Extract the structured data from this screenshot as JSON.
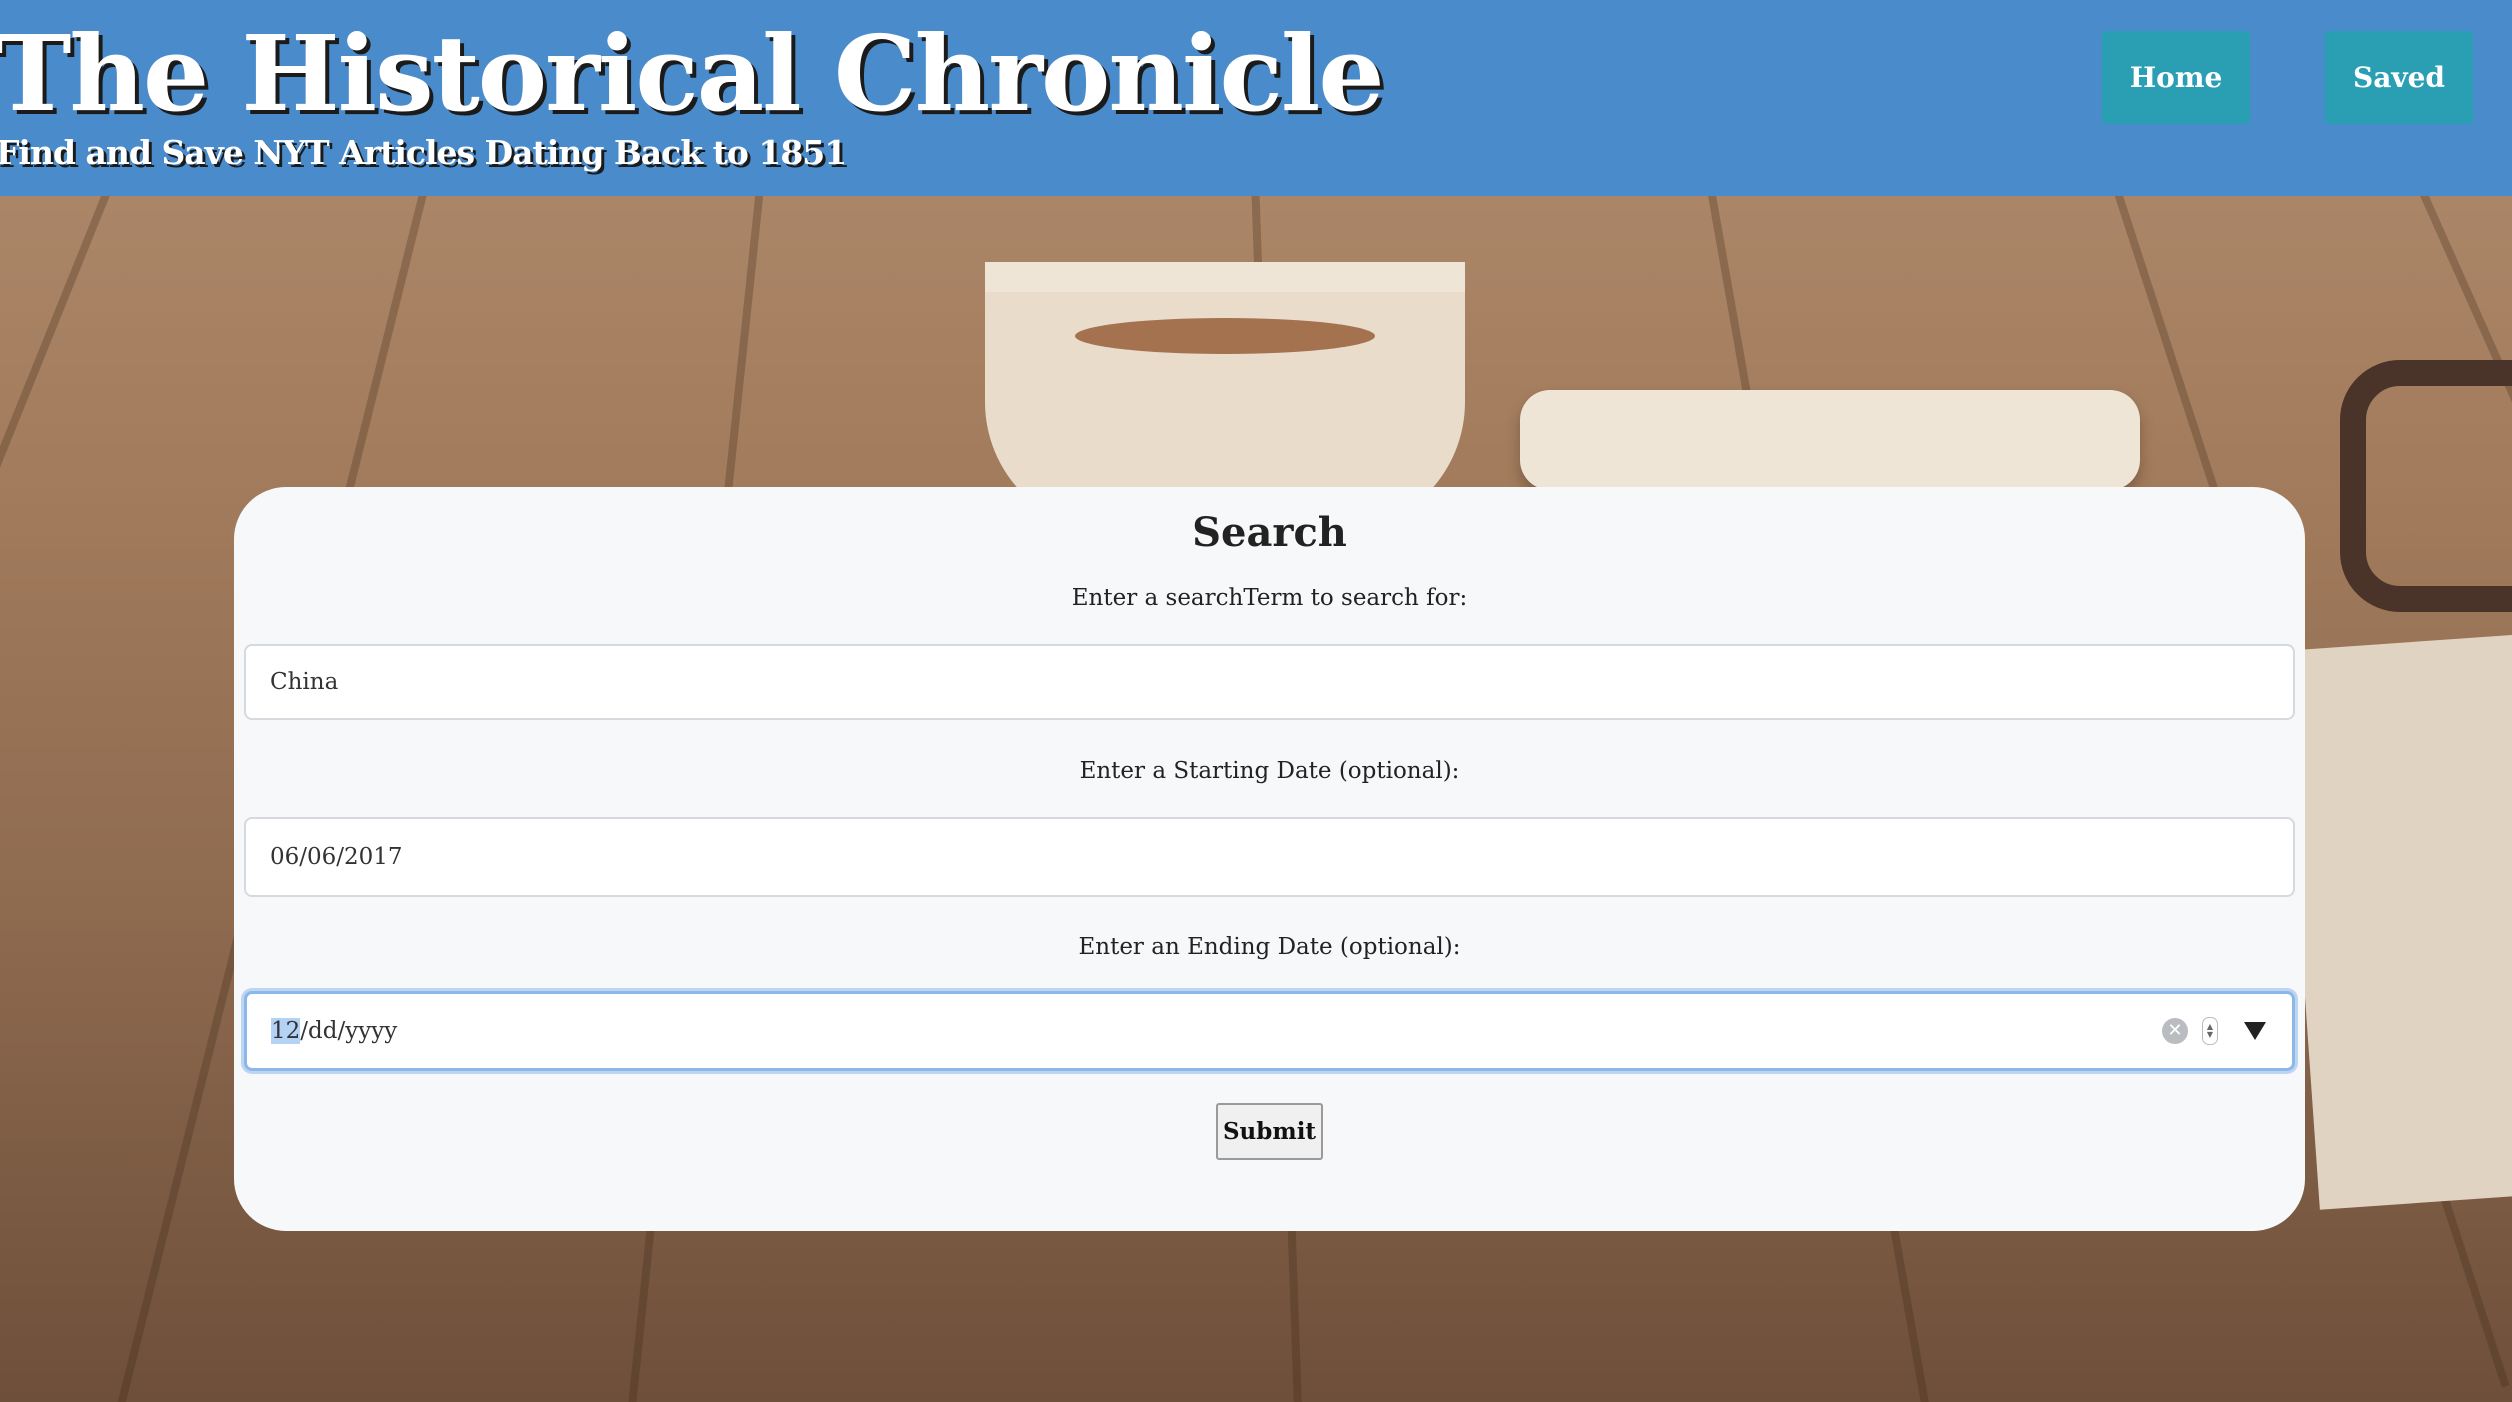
{
  "header": {
    "title": "The Historical Chronicle",
    "subtitle": "Find and Save NYT Articles Dating Back to 1851",
    "nav": {
      "home_label": "Home",
      "saved_label": "Saved"
    },
    "background_color": "#4a8ccb",
    "button_color": "#2a9fb4"
  },
  "search": {
    "title": "Search",
    "term_label": "Enter a searchTerm to search for:",
    "term_value": "China",
    "start_label": "Enter a Starting Date (optional):",
    "start_value": "06/06/2017",
    "end_label": "Enter an Ending Date (optional):",
    "end_value": {
      "month": "12",
      "rest": "/dd/yyyy"
    },
    "submit_label": "Submit",
    "icons": [
      "clear-icon",
      "spin-icon",
      "dropdown-icon"
    ]
  }
}
